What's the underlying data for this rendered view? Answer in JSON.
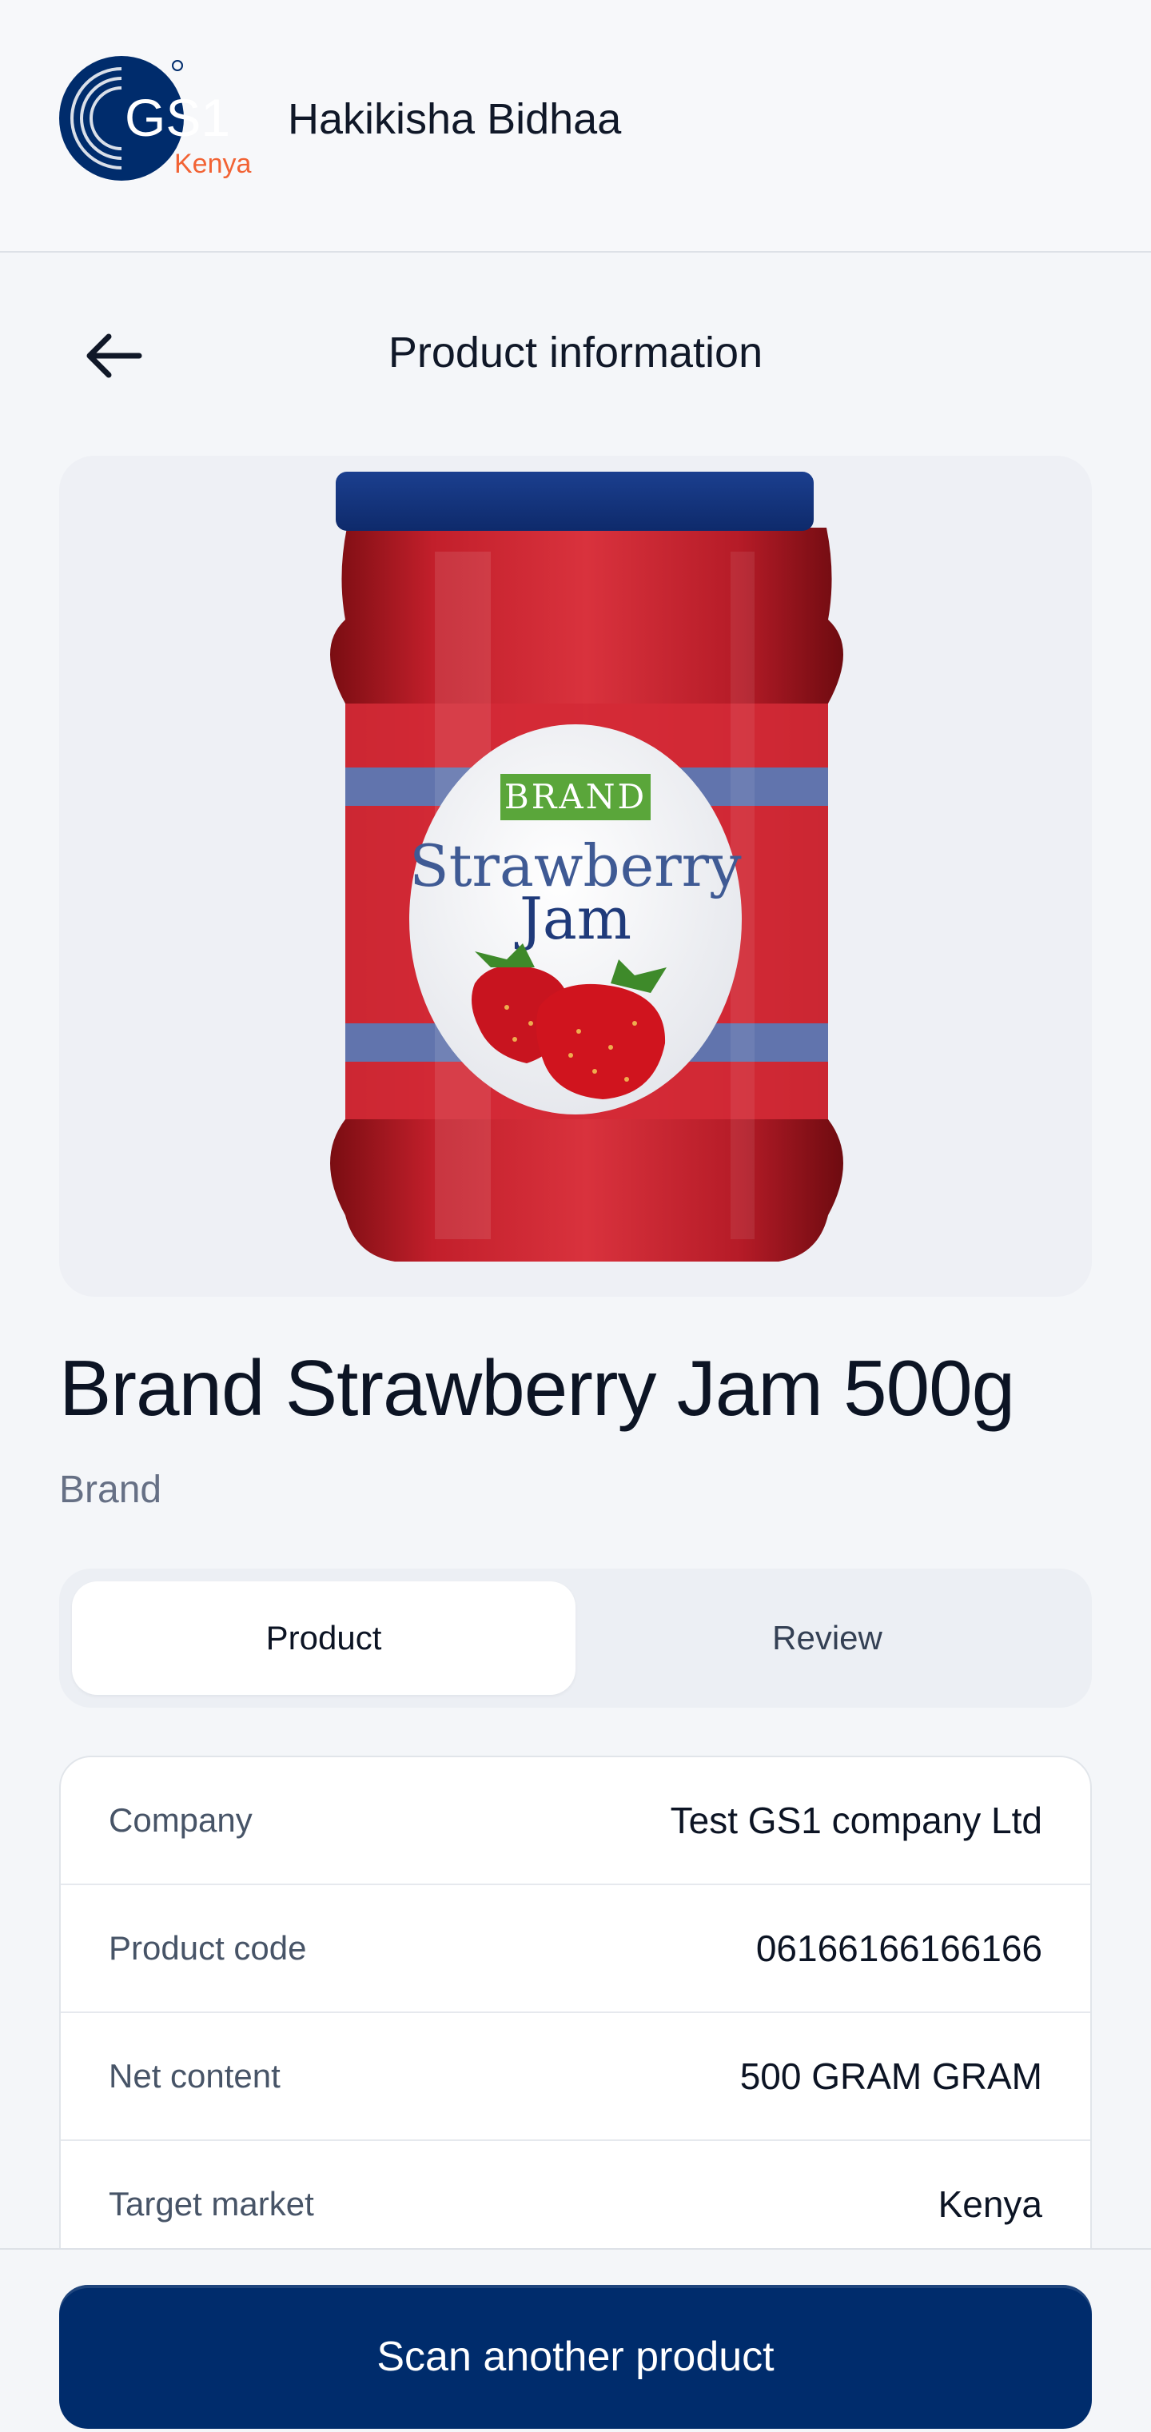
{
  "header": {
    "logo_text": "GS1",
    "logo_sub": "Kenya",
    "app_title": "Hakikisha Bidhaa"
  },
  "titlebar": {
    "title": "Product information",
    "back_icon": "arrow-left-icon"
  },
  "product": {
    "image_label_brand": "BRAND",
    "image_label_line1": "Strawberry",
    "image_label_line2": "Jam",
    "name": "Brand Strawberry Jam 500g",
    "brand": "Brand"
  },
  "tabs": [
    {
      "label": "Product",
      "active": true
    },
    {
      "label": "Review",
      "active": false
    }
  ],
  "info": [
    {
      "label": "Company",
      "value": "Test GS1 company Ltd"
    },
    {
      "label": "Product code",
      "value": "06166166166166"
    },
    {
      "label": "Net content",
      "value": "500 GRAM GRAM"
    },
    {
      "label": "Target market",
      "value": "Kenya"
    }
  ],
  "actions": {
    "scan_label": "Scan another product"
  },
  "colors": {
    "primary": "#002c6c",
    "logo_orange": "#f26334",
    "background": "#f4f6f9"
  }
}
